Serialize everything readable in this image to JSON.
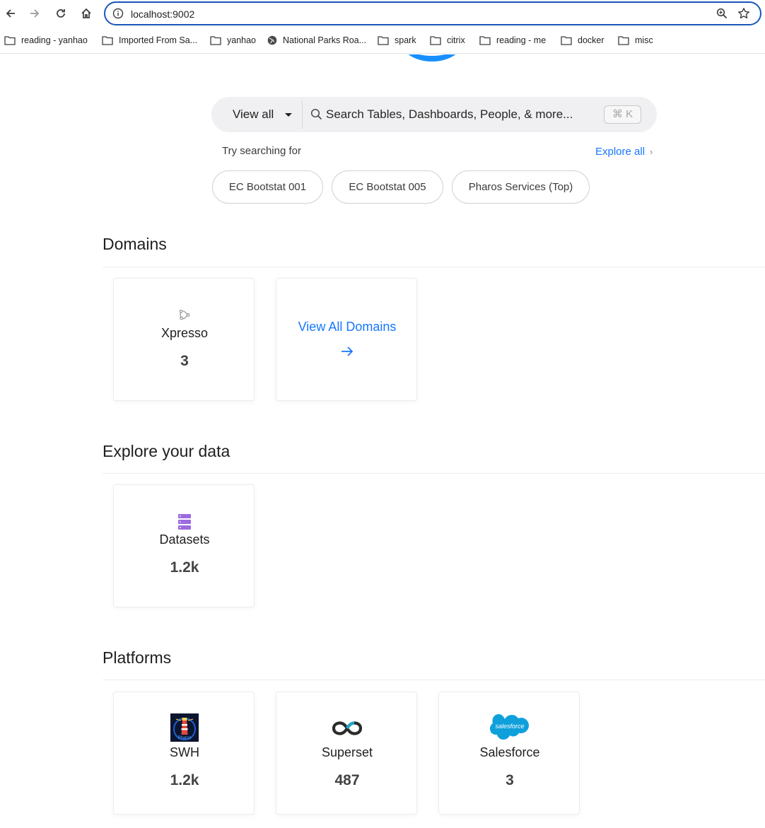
{
  "browser": {
    "url": "localhost:9002",
    "icons": [
      "back-icon",
      "forward-icon",
      "reload-icon",
      "home-icon",
      "info-icon",
      "zoom-icon",
      "star-icon"
    ],
    "bookmarks": [
      {
        "label": "reading - yanhao",
        "icon": "folder-icon"
      },
      {
        "label": "Imported From Sa...",
        "icon": "folder-icon"
      },
      {
        "label": "yanhao",
        "icon": "folder-icon"
      },
      {
        "label": "National Parks Roa...",
        "icon": "globe-icon"
      },
      {
        "label": "spark",
        "icon": "folder-icon"
      },
      {
        "label": "citrix",
        "icon": "folder-icon"
      },
      {
        "label": "reading - me",
        "icon": "folder-icon"
      },
      {
        "label": "docker",
        "icon": "folder-icon"
      },
      {
        "label": "misc",
        "icon": "folder-icon"
      }
    ]
  },
  "search": {
    "type_label": "View all",
    "placeholder": "Search Tables, Dashboards, People, & more...",
    "shortcut": "⌘ K"
  },
  "suggestions": {
    "label": "Try searching for",
    "explore_all": "Explore all",
    "chips": [
      "EC Bootstat 001",
      "EC Bootstat 005",
      "Pharos Services (Top)"
    ]
  },
  "domains": {
    "title": "Domains",
    "cards": [
      {
        "name": "Xpresso",
        "count": "3",
        "icon": "domain-icon"
      }
    ],
    "view_all_label": "View All Domains"
  },
  "explore": {
    "title": "Explore your data",
    "cards": [
      {
        "name": "Datasets",
        "count": "1.2k",
        "icon": "dataset-icon"
      }
    ]
  },
  "platforms": {
    "title": "Platforms",
    "cards": [
      {
        "name": "SWH",
        "count": "1.2k",
        "icon": "pharos-logo-icon",
        "logo_text": "Pharos"
      },
      {
        "name": "Superset",
        "count": "487",
        "icon": "superset-logo-icon"
      },
      {
        "name": "Salesforce",
        "count": "3",
        "icon": "salesforce-logo-icon",
        "logo_text": "salesforce"
      }
    ]
  },
  "colors": {
    "accent": "#1677ff",
    "omnibox_border": "#1a56b8",
    "dataset_purple": "#9c6ade",
    "salesforce_blue": "#0fa0db"
  }
}
